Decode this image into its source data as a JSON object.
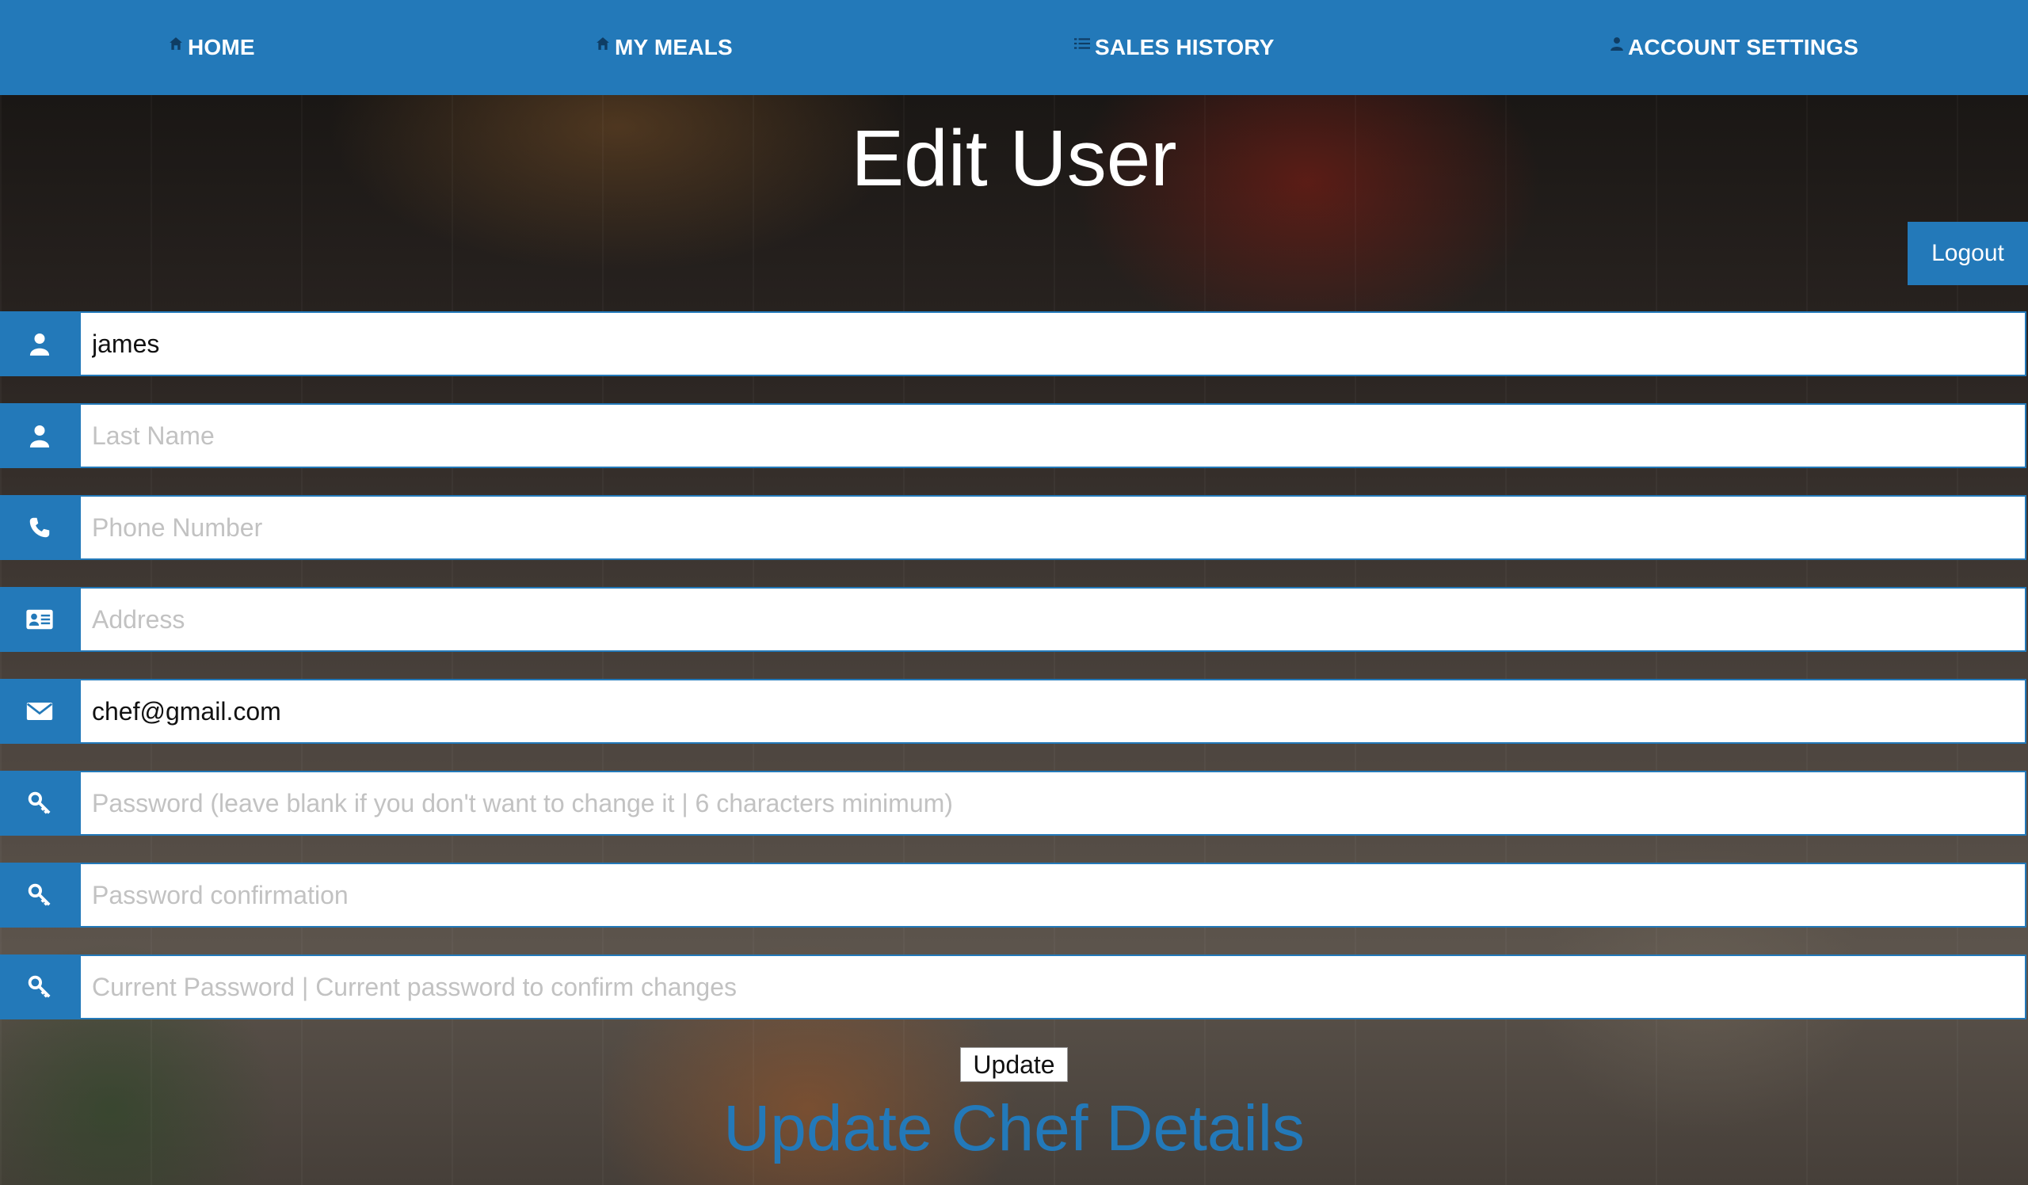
{
  "nav": {
    "items": [
      {
        "label": "HOME",
        "icon": "home-icon"
      },
      {
        "label": "MY MEALS",
        "icon": "home-icon"
      },
      {
        "label": "SALES HISTORY",
        "icon": "list-icon"
      },
      {
        "label": "ACCOUNT SETTINGS",
        "icon": "user-icon"
      }
    ]
  },
  "page": {
    "title": "Edit User",
    "logout_label": "Logout",
    "update_label": "Update",
    "subtitle": "Update Chef Details"
  },
  "form": {
    "fields": [
      {
        "icon": "user-icon",
        "value": "james",
        "placeholder": ""
      },
      {
        "icon": "user-icon",
        "value": "",
        "placeholder": "Last Name"
      },
      {
        "icon": "phone-icon",
        "value": "",
        "placeholder": "Phone Number"
      },
      {
        "icon": "address-card-icon",
        "value": "",
        "placeholder": "Address"
      },
      {
        "icon": "envelope-icon",
        "value": "chef@gmail.com",
        "placeholder": ""
      },
      {
        "icon": "key-icon",
        "value": "",
        "placeholder": "Password (leave blank if you don't want to change it | 6 characters minimum)"
      },
      {
        "icon": "key-icon",
        "value": "",
        "placeholder": "Password confirmation"
      },
      {
        "icon": "key-icon",
        "value": "",
        "placeholder": "Current Password | Current password to confirm changes"
      }
    ]
  },
  "colors": {
    "brand": "#2379b9",
    "nav_text": "#ffffff",
    "placeholder": "#c2c2c2"
  }
}
